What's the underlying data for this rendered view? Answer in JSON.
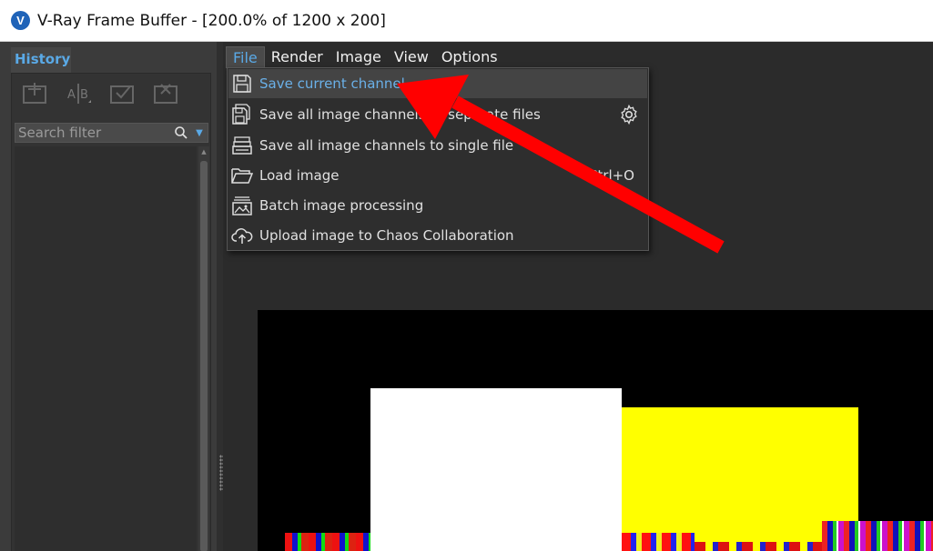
{
  "window": {
    "title": "V-Ray Frame Buffer - [200.0% of 1200 x 200]",
    "logo_letter": "V"
  },
  "history": {
    "tab_label": "History",
    "tools": [
      "add-history-icon",
      "ab-compare-icon",
      "load-history-icon",
      "remove-history-icon"
    ],
    "search_placeholder": "Search filter"
  },
  "menubar": {
    "items": [
      "File",
      "Render",
      "Image",
      "View",
      "Options"
    ],
    "active": "File"
  },
  "file_menu": {
    "items": [
      {
        "label": "Save current channel",
        "icon": "save-icon",
        "highlighted": true
      },
      {
        "label": "Save all image channels to separate files",
        "icon": "save-multiple-icon",
        "has_settings": true
      },
      {
        "label": "Save all image channels to single file",
        "icon": "save-single-stack-icon"
      },
      {
        "label": "Load image",
        "icon": "folder-open-icon",
        "shortcut": "Ctrl+O"
      },
      {
        "label": "Batch image processing",
        "icon": "batch-images-icon"
      },
      {
        "label": "Upload image to Chaos Collaboration",
        "icon": "cloud-upload-icon"
      }
    ]
  },
  "colors": {
    "accent": "#5aa9e6",
    "annotation_arrow": "#ff0000",
    "render_yellow": "#ffff00",
    "render_white": "#ffffff"
  }
}
